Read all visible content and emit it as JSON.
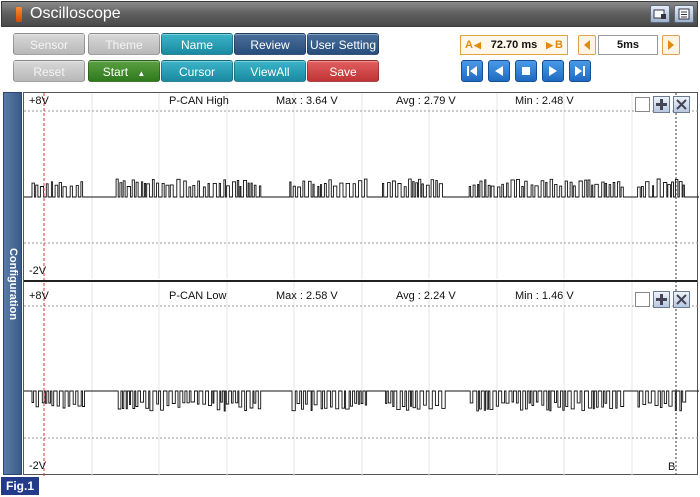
{
  "window": {
    "title": "Oscilloscope"
  },
  "toolbar": {
    "buttons": [
      {
        "label": "Sensor",
        "style": "grey"
      },
      {
        "label": "Theme",
        "style": "grey"
      },
      {
        "label": "Name",
        "style": "teal"
      },
      {
        "label": "Review",
        "style": "navy"
      },
      {
        "label": "User Setting",
        "style": "navy"
      },
      {
        "label": "Reset",
        "style": "grey"
      },
      {
        "label": "Start",
        "style": "green"
      },
      {
        "label": "Cursor",
        "style": "teal"
      },
      {
        "label": "ViewAll",
        "style": "teal"
      },
      {
        "label": "Save",
        "style": "red"
      }
    ],
    "cursor_a_label": "A",
    "cursor_b_label": "B",
    "cursor_delta": "72.70 ms",
    "timebase": "5ms"
  },
  "side_tab": {
    "label": "Configuration"
  },
  "panels": [
    {
      "top_label": "+8V",
      "bottom_label": "-2V",
      "channel": "P-CAN High",
      "max": "Max : 3.64 V",
      "avg": "Avg : 2.79 V",
      "min": "Min : 2.48 V"
    },
    {
      "top_label": "+8V",
      "bottom_label": "-2V",
      "channel": "P-CAN Low",
      "max": "Max : 2.58 V",
      "avg": "Avg : 2.24 V",
      "min": "Min : 1.46 V"
    }
  ],
  "marker_b": "B",
  "figure_label": "Fig.1",
  "colors": {
    "titlebar": "#5e5e5e",
    "teal_button": "#1a8aa2",
    "navy_button": "#274d7c",
    "green_button": "#2f7a1c",
    "red_button": "#c03434",
    "playback_button": "#1f6ac2",
    "cursor_a_line": "#e03030",
    "figure_label_bg": "#243b8c"
  }
}
